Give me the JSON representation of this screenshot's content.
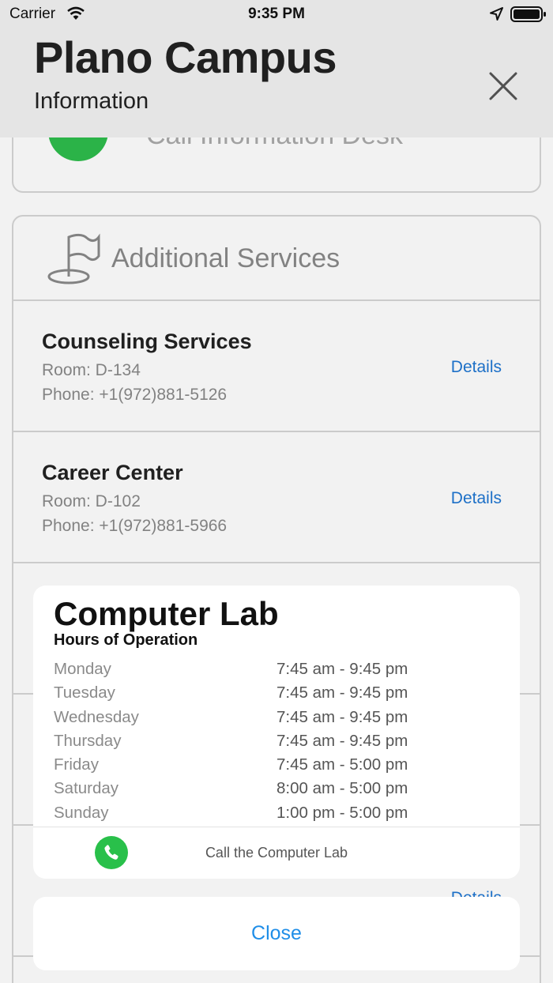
{
  "status_bar": {
    "carrier": "Carrier",
    "time": "9:35 PM",
    "icons": [
      "wifi-icon",
      "location-arrow-icon",
      "battery-icon"
    ]
  },
  "header": {
    "title": "Plano Campus",
    "subtitle": "Information",
    "close_icon": "close-icon"
  },
  "top_card": {
    "call_label": "Call Information Desk",
    "icon": "phone-icon"
  },
  "services": {
    "title": "Additional Services",
    "icon": "flag-icon",
    "details_label": "Details",
    "items": [
      {
        "name": "Counseling Services",
        "room": "Room: D-134",
        "phone": "Phone: +1(972)881-5126"
      },
      {
        "name": "Career Center",
        "room": "Room: D-102",
        "phone": "Phone: +1(972)881-5966"
      }
    ]
  },
  "sheet": {
    "title": "Computer Lab",
    "subtitle": "Hours of Operation",
    "hours": [
      {
        "day": "Monday",
        "time": "7:45 am - 9:45 pm"
      },
      {
        "day": "Tuesday",
        "time": "7:45 am - 9:45 pm"
      },
      {
        "day": "Wednesday",
        "time": "7:45 am - 9:45 pm"
      },
      {
        "day": "Thursday",
        "time": "7:45 am - 9:45 pm"
      },
      {
        "day": "Friday",
        "time": "7:45 am - 5:00 pm"
      },
      {
        "day": "Saturday",
        "time": "8:00 am - 5:00 pm"
      },
      {
        "day": "Sunday",
        "time": "1:00 pm - 5:00 pm"
      }
    ],
    "call_label": "Call the Computer Lab",
    "close_label": "Close"
  },
  "colors": {
    "accent": "#1f76d2",
    "close_text": "#1f8ee8",
    "call_green": "#29c04a",
    "header_bg": "#f2f2f2",
    "dim": "rgba(0,0,0,0.05)"
  }
}
